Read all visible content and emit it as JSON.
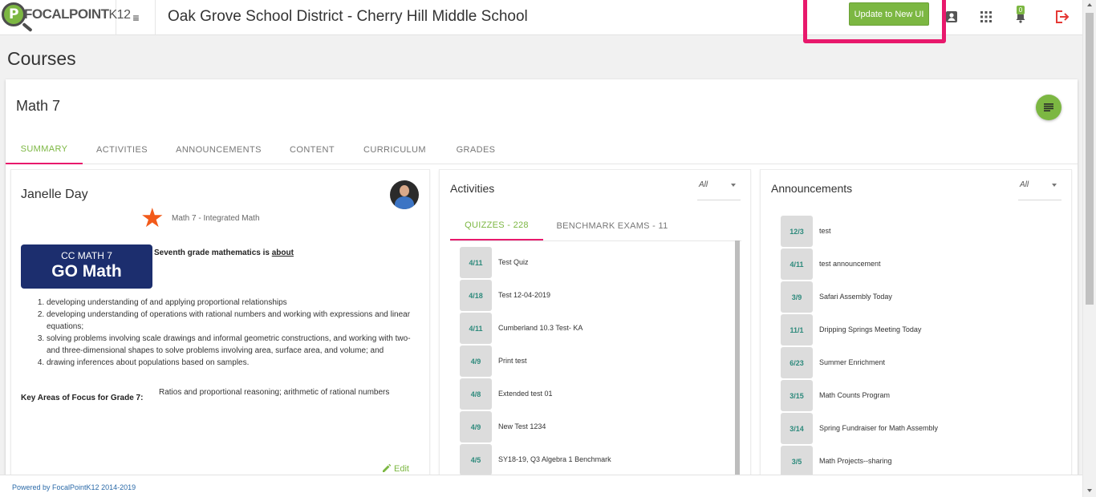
{
  "brand": {
    "name": "FOCALPOINT",
    "suffix": "K12",
    "logo_letter": "P"
  },
  "header": {
    "menu_icon": "≡",
    "district": "Oak Grove School District - Cherry Hill Middle School",
    "update_button": "Update to New UI",
    "notification_count": "0"
  },
  "page": {
    "title": "Courses"
  },
  "course": {
    "title": "Math 7",
    "tabs": [
      {
        "label": "SUMMARY"
      },
      {
        "label": "ACTIVITIES"
      },
      {
        "label": "ANNOUNCEMENTS"
      },
      {
        "label": "CONTENT"
      },
      {
        "label": "CURRICULUM"
      },
      {
        "label": "GRADES"
      }
    ]
  },
  "teacher_panel": {
    "name": "Janelle Day",
    "course_subtitle": "Math 7 - Integrated Math",
    "badge_line1": "CC MATH 7",
    "badge_line2": "GO Math",
    "intro_prefix": "Seventh grade mathematics is",
    "intro_link": "about",
    "goals": [
      "developing understanding of and applying proportional relationships",
      "developing understanding of operations with rational numbers and working with expressions and linear equations;",
      "solving problems involving scale drawings and informal geometric constructions, and working with two- and three-dimensional shapes to solve problems involving area, surface area, and volume; and",
      "drawing inferences about populations based on samples."
    ],
    "focus_label": "Key Areas of Focus for Grade 7:",
    "focus_value": "Ratios and proportional reasoning; arithmetic of rational numbers",
    "edit_label": "Edit"
  },
  "activities_panel": {
    "title": "Activities",
    "filter": "All",
    "tabs": [
      {
        "label": "QUIZZES - 228"
      },
      {
        "label": "BENCHMARK EXAMS - 11"
      }
    ],
    "items": [
      {
        "date": "4/11",
        "text": "Test Quiz"
      },
      {
        "date": "4/18",
        "text": "Test 12-04-2019"
      },
      {
        "date": "4/11",
        "text": "Cumberland 10.3 Test- KA"
      },
      {
        "date": "4/9",
        "text": "Print test"
      },
      {
        "date": "4/8",
        "text": "Extended test 01"
      },
      {
        "date": "4/9",
        "text": "New Test 1234"
      },
      {
        "date": "4/5",
        "text": "SY18-19, Q3 Algebra 1 Benchmark"
      }
    ]
  },
  "announcements_panel": {
    "title": "Announcements",
    "filter": "All",
    "items": [
      {
        "date": "12/3",
        "text": "test"
      },
      {
        "date": "4/11",
        "text": "test announcement"
      },
      {
        "date": "3/9",
        "text": "Safari Assembly Today"
      },
      {
        "date": "11/1",
        "text": "Dripping Springs Meeting Today"
      },
      {
        "date": "6/23",
        "text": "Summer Enrichment"
      },
      {
        "date": "3/15",
        "text": "Math Counts Program"
      },
      {
        "date": "3/14",
        "text": "Spring Fundraiser for Math Assembly"
      },
      {
        "date": "3/5",
        "text": "Math Projects--sharing"
      }
    ]
  },
  "footer": {
    "text": "Powered by FocalPointK12 2014-2019"
  },
  "colors": {
    "accent": "#7cb742",
    "highlight": "#e8196c",
    "date_text": "#2d8a7c",
    "star": "#f25a1a"
  }
}
